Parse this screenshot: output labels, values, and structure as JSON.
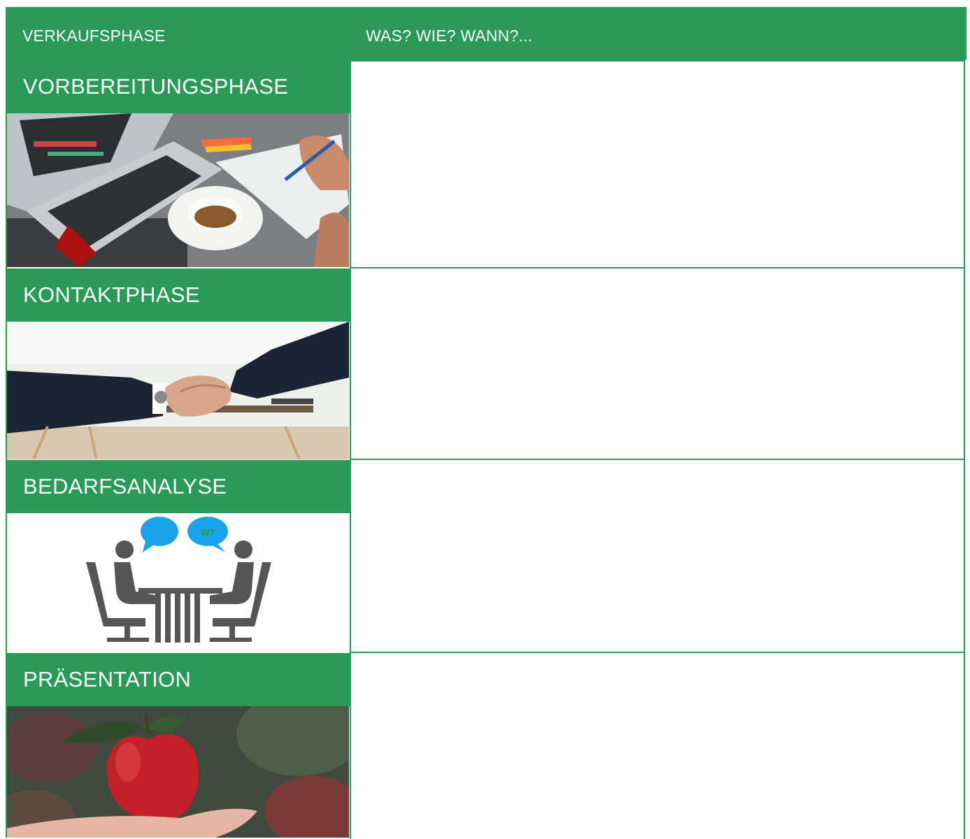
{
  "header": {
    "col1": "VERKAUFSPHASE",
    "col2": "WAS? WIE? WANN?..."
  },
  "phases": [
    {
      "title": "VORBEREITUNGSPHASE",
      "image": "laptop-coffee-notes-photo"
    },
    {
      "title": "KONTAKTPHASE",
      "image": "handshake-photo"
    },
    {
      "title": "BEDARFSANALYSE",
      "image": "conversation-icon",
      "bubble_text": "W?"
    },
    {
      "title": "PRÄSENTATION",
      "image": "apple-on-hand-photo"
    }
  ],
  "colors": {
    "accent": "#2a9a59",
    "bubble": "#1aa3e8",
    "figure": "#555555"
  }
}
